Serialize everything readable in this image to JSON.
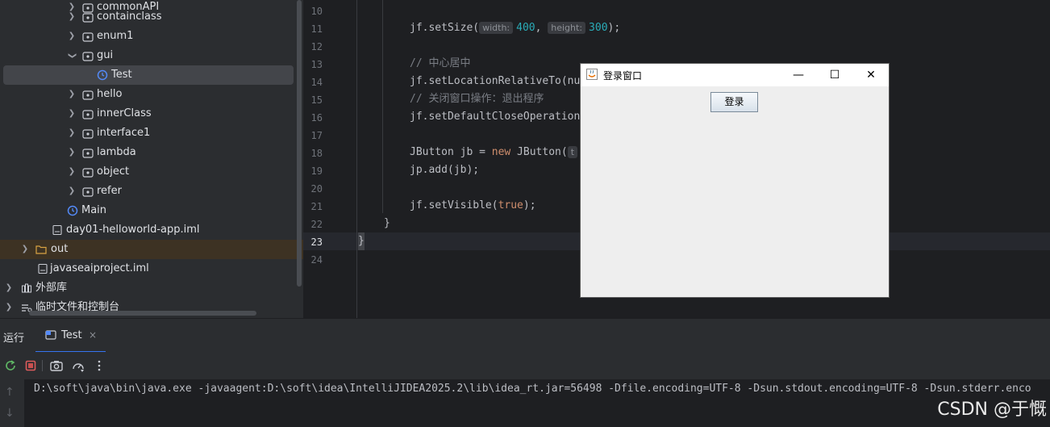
{
  "tree": {
    "items": [
      {
        "label": "commonAPI",
        "type": "package",
        "depth": 2,
        "expanded": false
      },
      {
        "label": "containclass",
        "type": "package",
        "depth": 2,
        "expanded": false
      },
      {
        "label": "enum1",
        "type": "package",
        "depth": 2,
        "expanded": false
      },
      {
        "label": "gui",
        "type": "package",
        "depth": 2,
        "expanded": true
      },
      {
        "label": "Test",
        "type": "class",
        "depth": 3,
        "selected": true
      },
      {
        "label": "hello",
        "type": "package",
        "depth": 2,
        "expanded": false
      },
      {
        "label": "innerClass",
        "type": "package",
        "depth": 2,
        "expanded": false
      },
      {
        "label": "interface1",
        "type": "package",
        "depth": 2,
        "expanded": false
      },
      {
        "label": "lambda",
        "type": "package",
        "depth": 2,
        "expanded": false
      },
      {
        "label": "object",
        "type": "package",
        "depth": 2,
        "expanded": false
      },
      {
        "label": "refer",
        "type": "package",
        "depth": 2,
        "expanded": false
      },
      {
        "label": "Main",
        "type": "class",
        "depth": 1
      },
      {
        "label": "day01-helloworld-app.iml",
        "type": "file",
        "depth": 1
      },
      {
        "label": "out",
        "type": "folder",
        "depth": 0,
        "expanded": false,
        "highlight": true
      },
      {
        "label": "javaseaiproject.iml",
        "type": "file",
        "depth": 0
      },
      {
        "label": "外部库",
        "type": "library",
        "depth": -1,
        "expanded": false
      },
      {
        "label": "临时文件和控制台",
        "type": "scratch",
        "depth": -1,
        "expanded": false
      }
    ]
  },
  "editor": {
    "line_numbers": [
      "10",
      "11",
      "12",
      "13",
      "14",
      "15",
      "16",
      "17",
      "18",
      "19",
      "20",
      "21",
      "22",
      "23",
      "24"
    ],
    "current_line": "23",
    "lines": {
      "l11_pre": "jf.setSize(",
      "l11_hint1": "width:",
      "l11_v1": "400",
      "l11_sep": ", ",
      "l11_hint2": "height:",
      "l11_v2": "300",
      "l11_post": ");",
      "l13": "// 中心居中",
      "l14": "jf.setLocationRelativeTo(nu",
      "l15": "// 关闭窗口操作：退出程序",
      "l16": "jf.setDefaultCloseOperation",
      "l18_pre": "JButton jb = ",
      "l18_kw": "new",
      "l18_post": " JButton(",
      "l18_hint": "t",
      "l19": "jp.add(jb);",
      "l21_pre": "jf.setVisible(",
      "l21_kw": "true",
      "l21_post": ");",
      "l22": "}",
      "l23": "}"
    }
  },
  "swing_window": {
    "title": "登录窗口",
    "button_label": "登录",
    "minimize": "—",
    "maximize": "☐",
    "close": "✕"
  },
  "run_panel": {
    "label": "运行",
    "tab_label": "Test",
    "tab_close": "×",
    "console_line": "D:\\soft\\java\\bin\\java.exe -javaagent:D:\\soft\\idea\\IntelliJIDEA2025.2\\lib\\idea_rt.jar=56498 -Dfile.encoding=UTF-8 -Dsun.stdout.encoding=UTF-8 -Dsun.stderr.enco",
    "up_arrow": "↑",
    "down_arrow": "↓"
  },
  "watermark": "CSDN @于慨",
  "colors": {
    "accent": "#3574f0",
    "stop": "#c94f4f",
    "keyword": "#cf8e6d",
    "number": "#2aacb8",
    "comment": "#7a7e85"
  }
}
